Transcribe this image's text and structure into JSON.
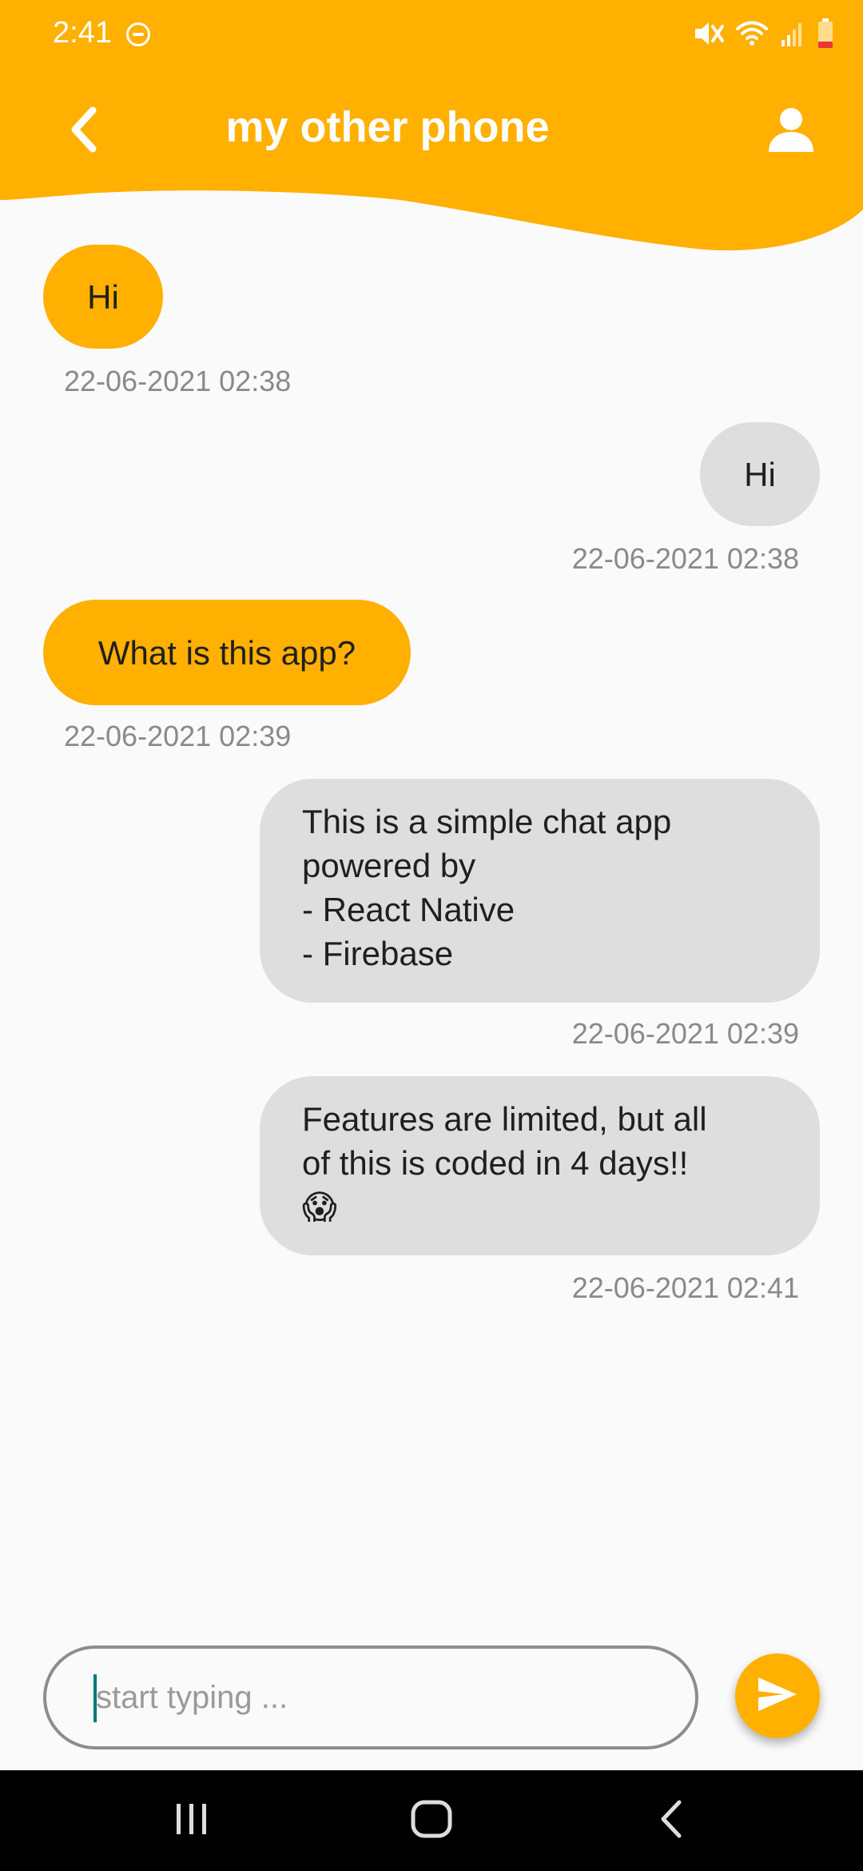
{
  "status_bar": {
    "time": "2:41",
    "icons": [
      "do-not-disturb-icon",
      "mute-icon",
      "wifi-icon",
      "signal-icon",
      "battery-low-icon"
    ]
  },
  "header": {
    "title": "my other phone",
    "back_icon": "chevron-left-icon",
    "profile_icon": "person-icon"
  },
  "messages": [
    {
      "direction": "received",
      "text": "Hi",
      "timestamp": "22-06-2021 02:38"
    },
    {
      "direction": "sent",
      "text": "Hi",
      "timestamp": "22-06-2021 02:38"
    },
    {
      "direction": "received",
      "text": "What is this app?",
      "timestamp": "22-06-2021 02:39"
    },
    {
      "direction": "sent",
      "text": "This is a simple chat app\npowered by\n- React Native\n- Firebase",
      "timestamp": "22-06-2021 02:39"
    },
    {
      "direction": "sent",
      "text": "Features are limited, but all\nof this is coded in 4 days!!\n😱",
      "timestamp": "22-06-2021 02:41"
    }
  ],
  "composer": {
    "placeholder": "start typing ...",
    "value": "",
    "send_icon": "send-icon"
  },
  "nav_bar": {
    "icons": [
      "recent-apps-icon",
      "home-icon",
      "back-icon"
    ]
  },
  "colors": {
    "accent": "#FFB000",
    "sent_bubble": "#DEDEDE",
    "background": "#FAFAFA",
    "timestamp": "#8A8A8A"
  }
}
